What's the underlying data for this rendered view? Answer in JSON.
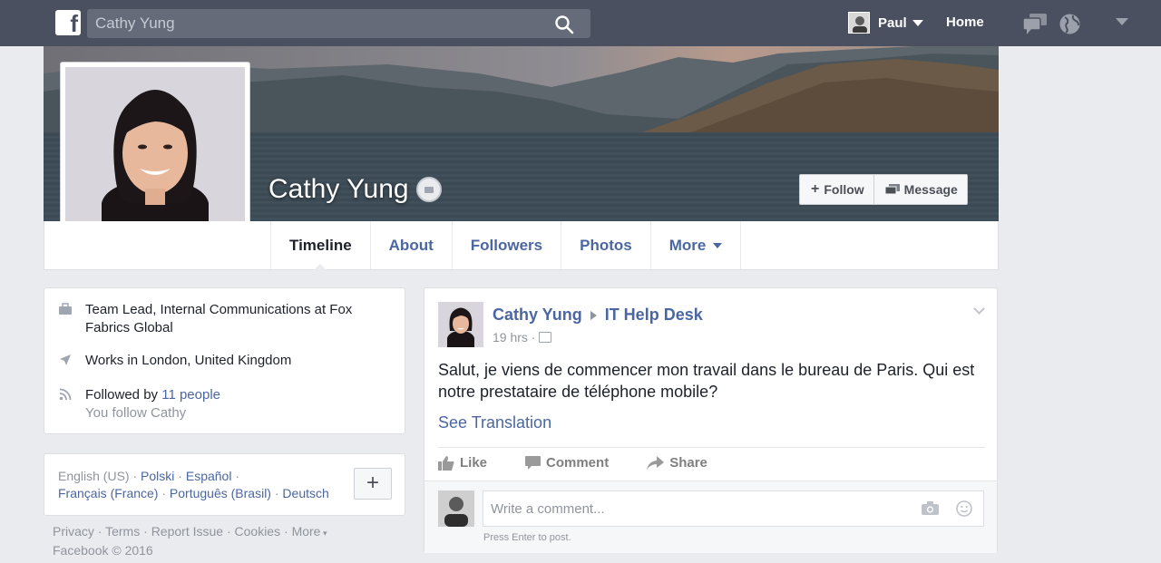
{
  "topbar": {
    "logo": "f",
    "search_value": "Cathy Yung",
    "user_name": "Paul",
    "home_label": "Home",
    "icons": [
      "friend-requests-icon",
      "messages-icon",
      "notifications-globe-icon",
      "account-menu-caret-icon"
    ]
  },
  "profile": {
    "name": "Cathy Yung",
    "follow_label": "Follow",
    "message_label": "Message"
  },
  "tabs": [
    {
      "label": "Timeline",
      "active": true
    },
    {
      "label": "About"
    },
    {
      "label": "Followers"
    },
    {
      "label": "Photos"
    },
    {
      "label": "More"
    }
  ],
  "intro": {
    "work_line1": "Team Lead, Internal Communications at Fox",
    "work_line2": "Fabrics Global",
    "location": "Works in London, United Kingdom",
    "followed_prefix": "Followed by",
    "followed_link": "11 people",
    "you_follow": "You follow Cathy"
  },
  "languages": {
    "current": "English (US)",
    "others_line1": [
      "Polski",
      "Español"
    ],
    "others_line2": [
      "Français (France)",
      "Português (Brasil)",
      "Deutsch"
    ],
    "add_label": "+"
  },
  "footer": {
    "links": [
      "Privacy",
      "Terms",
      "Report Issue",
      "Cookies",
      "More"
    ],
    "copyright": "Facebook © 2016"
  },
  "post": {
    "author": "Cathy Yung",
    "target": "IT Help Desk",
    "time": "19 hrs",
    "body_line1": "Salut, je viens de commencer mon travail dans le bureau de Paris. Qui est",
    "body_line2": "notre prestataire de téléphone mobile?",
    "see_translation": "See Translation",
    "actions": [
      "Like",
      "Comment",
      "Share"
    ],
    "comment_placeholder": "Write a comment...",
    "comment_hint": "Press Enter to post."
  },
  "colors": {
    "topbar_bg": "#4a5060",
    "link": "#4b67a1",
    "page_bg": "#e9ebee"
  }
}
